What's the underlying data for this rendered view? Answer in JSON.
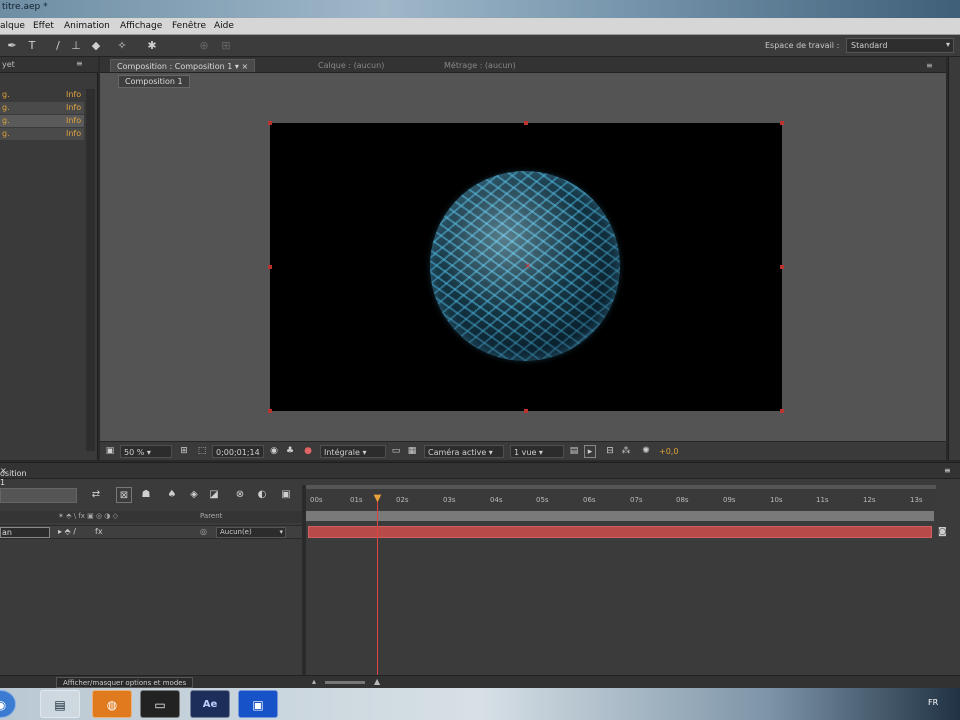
{
  "window": {
    "title": "titre.aep *"
  },
  "menu": [
    "alque",
    "Effet",
    "Animation",
    "Affichage",
    "Fenêtre",
    "Aide"
  ],
  "toolbar": {
    "workspace_label": "Espace de travail :",
    "workspace_value": "Standard"
  },
  "project_panel": {
    "header": "yet",
    "rows": [
      {
        "name": "g.",
        "info": "Info"
      },
      {
        "name": "g.",
        "info": "Info"
      },
      {
        "name": "g.",
        "info": "Info"
      },
      {
        "name": "g.",
        "info": "Info"
      }
    ]
  },
  "comp_panel": {
    "tabs": [
      "Composition : Composition 1",
      "Calque : (aucun)",
      "Métrage : (aucun)"
    ],
    "subtab": "Composition 1",
    "bottom": {
      "zoom": "50 %",
      "timecode": "0;00;01;14",
      "resolution": "Intégrale",
      "camera": "Caméra active",
      "views": "1 vue",
      "exposure": "+0,0"
    }
  },
  "timeline": {
    "tab": "osition 1",
    "parent_header": "Parent",
    "layer_name": "an",
    "parent_value": "Aucun(e)",
    "ruler_ticks": [
      "00s",
      "01s",
      "02s",
      "03s",
      "04s",
      "05s",
      "06s",
      "07s",
      "08s",
      "09s",
      "10s",
      "11s",
      "12s",
      "13s"
    ],
    "toggle_button": "Afficher/masquer options et modes"
  },
  "taskbar": {
    "lang": "FR",
    "apps": [
      "explorer",
      "firefox",
      "terminal",
      "Ae",
      "app"
    ]
  }
}
